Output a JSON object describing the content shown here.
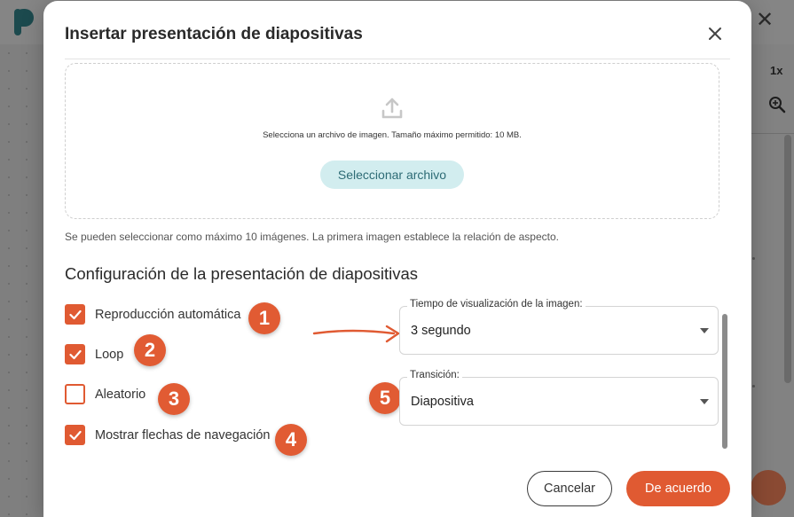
{
  "background": {
    "zoom_level": "1x",
    "icons": [
      "app-logo",
      "close-icon",
      "zoom-in-icon"
    ]
  },
  "dialog": {
    "title": "Insertar presentación de diapositivas",
    "close_icon": "close-icon",
    "upload": {
      "icon": "upload-icon",
      "instructions": "Selecciona un archivo de imagen. Tamaño máximo permitido: 10 MB.",
      "button_label": "Seleccionar archivo"
    },
    "hint": "Se pueden seleccionar como máximo 10 imágenes. La primera imagen establece la relación de aspecto.",
    "settings": {
      "heading": "Configuración de la presentación de diapositivas",
      "options": [
        {
          "label": "Reproducción automática",
          "checked": true,
          "badge": "1"
        },
        {
          "label": "Loop",
          "checked": true,
          "badge": "2"
        },
        {
          "label": "Aleatorio",
          "checked": false,
          "badge": "3"
        },
        {
          "label": "Mostrar flechas de navegación",
          "checked": true,
          "badge": "4"
        }
      ],
      "display_time": {
        "label": "Tiempo de visualización de la imagen:",
        "value": "3 segundo"
      },
      "transition": {
        "label": "Transición:",
        "value": "Diapositiva",
        "badge": "5"
      }
    },
    "actions": {
      "cancel_label": "Cancelar",
      "ok_label": "De acuerdo"
    }
  },
  "colors": {
    "accent": "#e05a32",
    "secondary_button_bg": "#d2edef",
    "secondary_button_text": "#2d6b75",
    "overlay": "#808080"
  }
}
